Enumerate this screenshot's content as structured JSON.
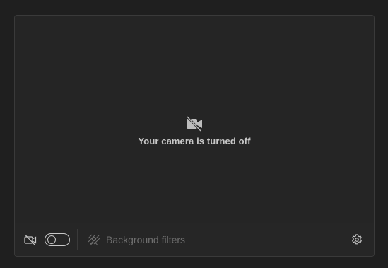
{
  "preview": {
    "message": "Your camera is turned off",
    "icon": "camera-off-icon"
  },
  "toolbar": {
    "camera_icon": "camera-off-icon",
    "camera_toggle_state": "off",
    "background_filters_label": "Background filters",
    "background_filters_icon": "background-effects-icon",
    "settings_icon": "gear-icon"
  },
  "colors": {
    "page_background": "#1f1f1f",
    "panel_background": "#252525",
    "text_primary": "#c8c8c8",
    "text_disabled": "#6e6e6e"
  }
}
